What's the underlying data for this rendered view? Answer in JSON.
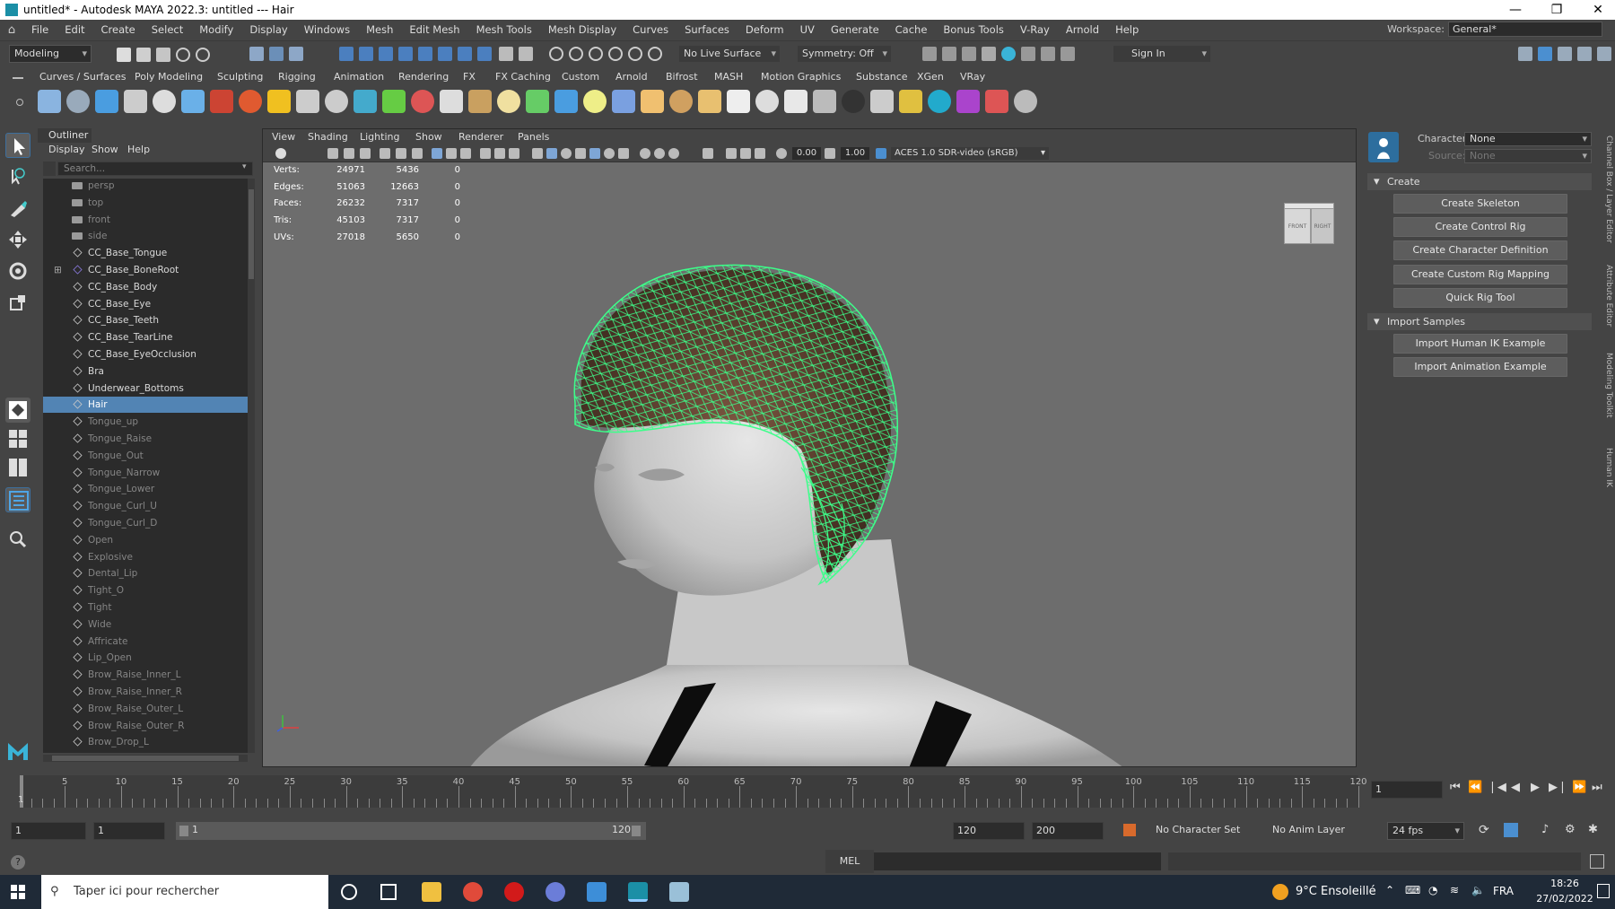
{
  "window": {
    "title": "untitled* - Autodesk MAYA 2022.3: untitled  ---  Hair",
    "minimize": "—",
    "restore": "❐",
    "close": "✕"
  },
  "menu": [
    "File",
    "Edit",
    "Create",
    "Select",
    "Modify",
    "Display",
    "Windows",
    "Mesh",
    "Edit Mesh",
    "Mesh Tools",
    "Mesh Display",
    "Curves",
    "Surfaces",
    "Deform",
    "UV",
    "Generate",
    "Cache",
    "Bonus Tools",
    "V-Ray",
    "Arnold",
    "Help"
  ],
  "workspace": {
    "label": "Workspace:",
    "value": "General*"
  },
  "statusline": {
    "mode": "Modeling",
    "live_surface": "No Live Surface",
    "symmetry": "Symmetry: Off",
    "signin": "Sign In"
  },
  "shelf_tabs": [
    "Curves / Surfaces",
    "Poly Modeling",
    "Sculpting",
    "Rigging",
    "Animation",
    "Rendering",
    "FX",
    "FX Caching",
    "Custom",
    "Arnold",
    "Bifrost",
    "MASH",
    "Motion Graphics",
    "Substance",
    "XGen",
    "VRay"
  ],
  "outliner": {
    "title": "Outliner",
    "menus": [
      "Display",
      "Show",
      "Help"
    ],
    "search_placeholder": "Search...",
    "items": [
      {
        "name": "persp",
        "type": "cam",
        "dim": true
      },
      {
        "name": "top",
        "type": "cam",
        "dim": true
      },
      {
        "name": "front",
        "type": "cam",
        "dim": true
      },
      {
        "name": "side",
        "type": "cam",
        "dim": true
      },
      {
        "name": "CC_Base_Tongue",
        "type": "mesh",
        "dim": false
      },
      {
        "name": "CC_Base_BoneRoot",
        "type": "joint",
        "dim": false
      },
      {
        "name": "CC_Base_Body",
        "type": "mesh",
        "dim": false
      },
      {
        "name": "CC_Base_Eye",
        "type": "mesh",
        "dim": false
      },
      {
        "name": "CC_Base_Teeth",
        "type": "mesh",
        "dim": false
      },
      {
        "name": "CC_Base_TearLine",
        "type": "mesh",
        "dim": false
      },
      {
        "name": "CC_Base_EyeOcclusion",
        "type": "mesh",
        "dim": false
      },
      {
        "name": "Bra",
        "type": "mesh",
        "dim": false
      },
      {
        "name": "Underwear_Bottoms",
        "type": "mesh",
        "dim": false
      },
      {
        "name": "Hair",
        "type": "mesh",
        "dim": false,
        "selected": true
      },
      {
        "name": "Tongue_up",
        "type": "mesh",
        "dim": true
      },
      {
        "name": "Tongue_Raise",
        "type": "mesh",
        "dim": true
      },
      {
        "name": "Tongue_Out",
        "type": "mesh",
        "dim": true
      },
      {
        "name": "Tongue_Narrow",
        "type": "mesh",
        "dim": true
      },
      {
        "name": "Tongue_Lower",
        "type": "mesh",
        "dim": true
      },
      {
        "name": "Tongue_Curl_U",
        "type": "mesh",
        "dim": true
      },
      {
        "name": "Tongue_Curl_D",
        "type": "mesh",
        "dim": true
      },
      {
        "name": "Open",
        "type": "mesh",
        "dim": true
      },
      {
        "name": "Explosive",
        "type": "mesh",
        "dim": true
      },
      {
        "name": "Dental_Lip",
        "type": "mesh",
        "dim": true
      },
      {
        "name": "Tight_O",
        "type": "mesh",
        "dim": true
      },
      {
        "name": "Tight",
        "type": "mesh",
        "dim": true
      },
      {
        "name": "Wide",
        "type": "mesh",
        "dim": true
      },
      {
        "name": "Affricate",
        "type": "mesh",
        "dim": true
      },
      {
        "name": "Lip_Open",
        "type": "mesh",
        "dim": true
      },
      {
        "name": "Brow_Raise_Inner_L",
        "type": "mesh",
        "dim": true
      },
      {
        "name": "Brow_Raise_Inner_R",
        "type": "mesh",
        "dim": true
      },
      {
        "name": "Brow_Raise_Outer_L",
        "type": "mesh",
        "dim": true
      },
      {
        "name": "Brow_Raise_Outer_R",
        "type": "mesh",
        "dim": true
      },
      {
        "name": "Brow_Drop_L",
        "type": "mesh",
        "dim": true
      }
    ]
  },
  "viewport": {
    "menus": [
      "View",
      "Shading",
      "Lighting",
      "Show",
      "Renderer",
      "Panels"
    ],
    "exposure": "0.00",
    "gamma": "1.00",
    "colorspace": "ACES 1.0 SDR-video (sRGB)",
    "hud": [
      {
        "label": "Verts:",
        "a": "24971",
        "b": "5436",
        "c": "0"
      },
      {
        "label": "Edges:",
        "a": "51063",
        "b": "12663",
        "c": "0"
      },
      {
        "label": "Faces:",
        "a": "26232",
        "b": "7317",
        "c": "0"
      },
      {
        "label": "Tris:",
        "a": "45103",
        "b": "7317",
        "c": "0"
      },
      {
        "label": "UVs:",
        "a": "27018",
        "b": "5650",
        "c": "0"
      }
    ],
    "viewcube": {
      "front": "FRONT",
      "right": "RIGHT"
    }
  },
  "humanik": {
    "character_label": "Character:",
    "character_value": "None",
    "source_label": "Source:",
    "source_value": "None",
    "create_section": "Create",
    "create_buttons": [
      "Create Skeleton",
      "Create Control Rig",
      "Create Character Definition",
      "Create Custom Rig Mapping",
      "Quick Rig Tool"
    ],
    "import_section": "Import Samples",
    "import_buttons": [
      "Import Human IK Example",
      "Import Animation Example"
    ]
  },
  "side_tabs": [
    "Channel Box / Layer Editor",
    "Attribute Editor",
    "Modeling Toolkit",
    "Human IK"
  ],
  "timeline": {
    "ticks": [
      5,
      10,
      15,
      20,
      25,
      30,
      35,
      40,
      45,
      50,
      55,
      60,
      65,
      70,
      75,
      80,
      85,
      90,
      95,
      100,
      105,
      110,
      115,
      120
    ],
    "current_frame_marker": "1",
    "current_frame": "1"
  },
  "range": {
    "start": "1",
    "anim_start": "1",
    "slider_start": "1",
    "slider_end": "120",
    "anim_end": "120",
    "end": "200",
    "character_set": "No Character Set",
    "anim_layer": "No Anim Layer",
    "fps": "24 fps"
  },
  "command": {
    "language": "MEL"
  },
  "taskbar": {
    "search_placeholder": "Taper ici pour rechercher",
    "weather": "9°C  Ensoleillé",
    "lang": "FRA",
    "time": "18:26",
    "date": "27/02/2022"
  },
  "colors": {
    "selection": "#5284b4",
    "wireframe": "#3dff8a",
    "viewport_bg": "#6d6d6d",
    "maya_teal": "#1b8fa6"
  }
}
